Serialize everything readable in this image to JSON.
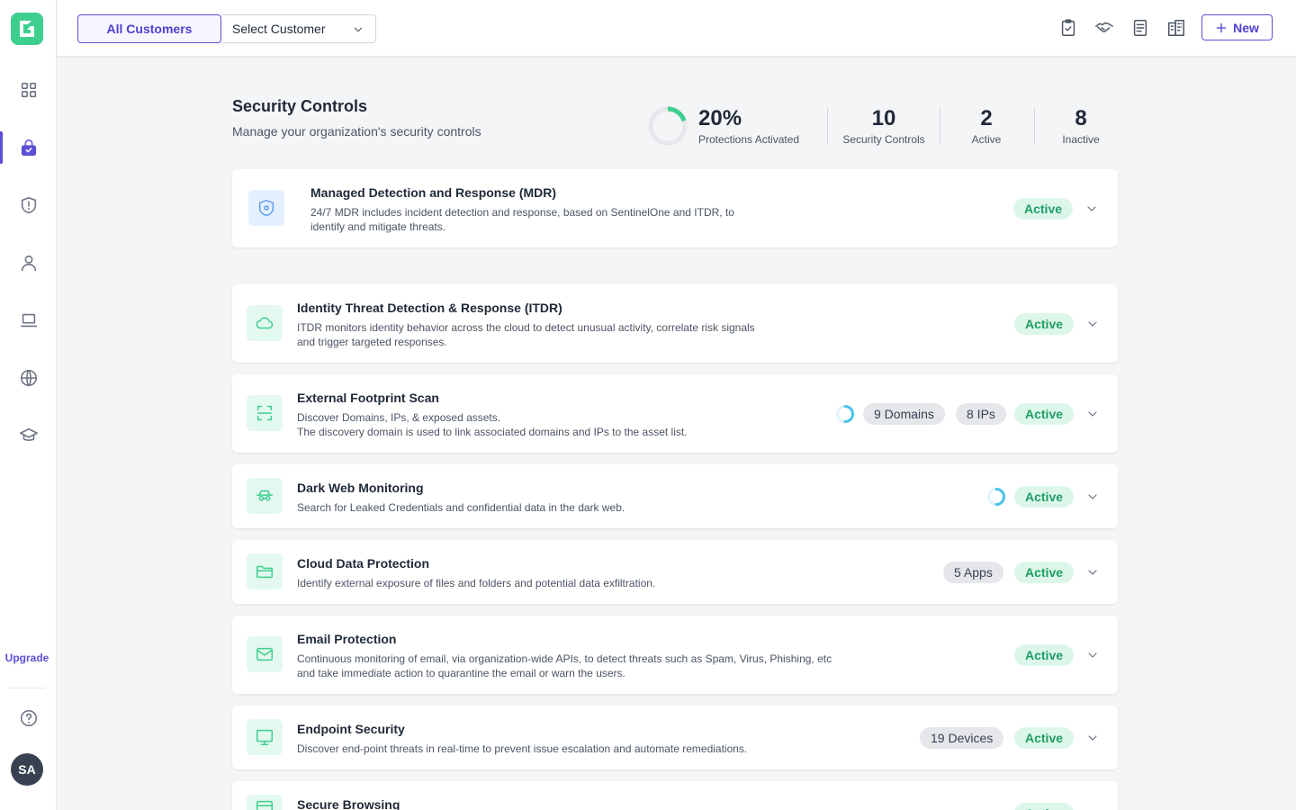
{
  "sidebar": {
    "logo_icon": "brand-logo-icon",
    "nav_items": [
      {
        "name": "dashboard",
        "icon": "grid-icon"
      },
      {
        "name": "security-controls",
        "icon": "lock-icon",
        "active": true
      },
      {
        "name": "threats",
        "icon": "shield-alert-icon"
      },
      {
        "name": "users",
        "icon": "user-icon"
      },
      {
        "name": "devices",
        "icon": "laptop-icon"
      },
      {
        "name": "domains",
        "icon": "globe-icon"
      },
      {
        "name": "training",
        "icon": "graduation-cap-icon"
      }
    ],
    "upgrade_label": "Upgrade",
    "help_icon": "help-circle-icon",
    "avatar_initials": "SA"
  },
  "topbar": {
    "all_customers_label": "All Customers",
    "select_customer_label": "Select Customer",
    "icons": [
      "clipboard-check-icon",
      "handshake-icon",
      "document-icon",
      "buildings-icon"
    ],
    "new_label": "New"
  },
  "header": {
    "title": "Security Controls",
    "subtitle": "Manage your organization's security controls",
    "stats": {
      "protections_pct": "20%",
      "protections_label": "Protections Activated",
      "protections_fraction": 0.2,
      "controls_count": "10",
      "controls_label": "Security Controls",
      "active_count": "2",
      "active_label": "Active",
      "inactive_count": "8",
      "inactive_label": "Inactive"
    }
  },
  "controls": [
    {
      "title": "Managed Detection and Response (MDR)",
      "desc_line1": "24/7 MDR includes incident detection and response, based on SentinelOne and ITDR, to",
      "desc_line2": "identify and mitigate threats.",
      "status": "Active",
      "icon": "shield-gear-icon"
    },
    {
      "title": "Identity Threat Detection & Response (ITDR)",
      "desc_line1": "ITDR monitors identity behavior across the cloud to detect unusual activity, correlate risk signals",
      "desc_line2": "and trigger targeted responses.",
      "status": "Active",
      "icon": "cloud-icon"
    },
    {
      "title": "External Footprint Scan",
      "desc_line1": "Discover Domains, IPs, & exposed assets.",
      "desc_line2": "The discovery domain is used to link associated domains and IPs to the asset list.",
      "chips": [
        "9 Domains",
        "8 IPs"
      ],
      "status": "Active",
      "icon": "scan-icon"
    },
    {
      "title": "Dark Web Monitoring",
      "desc_line1": "Search for Leaked Credentials and confidential data in the dark web.",
      "status": "Active",
      "icon": "spy-icon"
    },
    {
      "title": "Cloud Data Protection",
      "desc_line1": "Identify external exposure of files and folders and potential data exfiltration.",
      "chips": [
        "5 Apps"
      ],
      "status": "Active",
      "icon": "folder-icon"
    },
    {
      "title": "Email Protection",
      "desc_line1": "Continuous monitoring of email, via organization-wide APIs, to detect threats such as Spam, Virus, Phishing, etc",
      "desc_line2": "and take immediate action to quarantine the email or warn the users.",
      "status": "Active",
      "icon": "mail-icon"
    },
    {
      "title": "Endpoint Security",
      "desc_line1": "Discover end-point threats in real-time to prevent issue escalation and automate remediations.",
      "chips": [
        "19 Devices"
      ],
      "status": "Active",
      "icon": "monitor-icon"
    },
    {
      "title": "Secure Browsing",
      "status": "Active",
      "icon": "browser-icon"
    }
  ],
  "colors": {
    "accent": "#5b4fd6",
    "brand_green": "#3ecf8e",
    "active_bg": "#dcf7ea",
    "active_text": "#1f9d63",
    "spinner": "#4cc3ea"
  }
}
